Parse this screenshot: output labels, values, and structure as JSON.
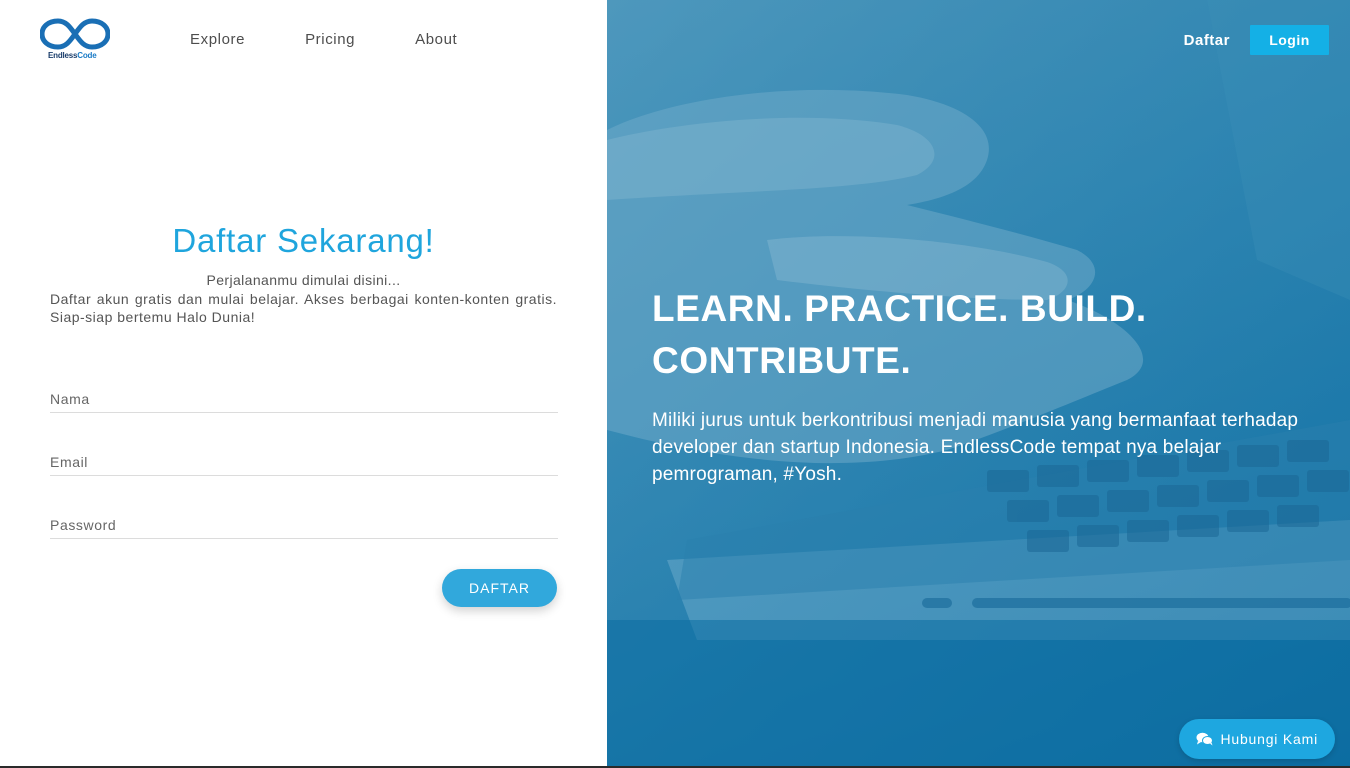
{
  "brand": {
    "logo_text_1": "Endless",
    "logo_text_2": "Code",
    "logo_icon": "infinity-logo-icon",
    "color": "#1a6fb5"
  },
  "nav": {
    "items": [
      {
        "label": "Explore"
      },
      {
        "label": "Pricing"
      },
      {
        "label": "About"
      }
    ]
  },
  "header_right": {
    "signup_label": "Daftar",
    "login_label": "Login"
  },
  "form": {
    "title": "Daftar Sekarang!",
    "subtitle": "Perjalananmu dimulai disini...",
    "description": "Daftar akun gratis dan mulai belajar. Akses berbagai konten-konten gratis. Siap-siap bertemu Halo Dunia!",
    "name_placeholder": "Nama",
    "email_placeholder": "Email",
    "password_placeholder": "Password",
    "submit_label": "DAFTAR"
  },
  "hero": {
    "headline_line1": "LEARN. PRACTICE. BUILD.",
    "headline_line2": "CONTRIBUTE.",
    "body": "Miliki jurus untuk berkontribusi menjadi manusia yang bermanfaat terhadap developer dan startup Indonesia. EndlessCode tempat nya belajar pemrograman, #Yosh."
  },
  "contact": {
    "label": "Hubungi Kami",
    "icon": "chat-bubbles-icon"
  },
  "colors": {
    "accent": "#1fa5dd",
    "button": "#31a8dc",
    "login": "#14b0e6",
    "overlay": "#1d7cad"
  }
}
